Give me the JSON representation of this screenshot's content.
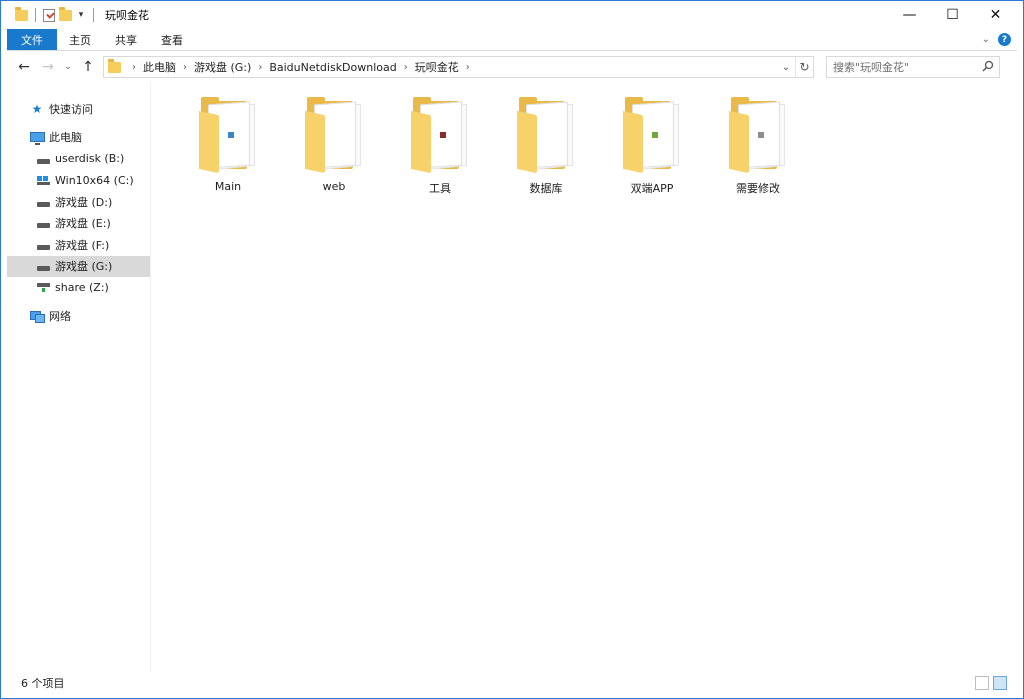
{
  "window": {
    "title": "玩呗金花",
    "controls": {
      "minimize": "—",
      "maximize": "☐",
      "close": "✕"
    }
  },
  "ribbon": {
    "tabs": [
      "文件",
      "主页",
      "共享",
      "查看"
    ]
  },
  "address": {
    "breadcrumbs": [
      "此电脑",
      "游戏盘 (G:)",
      "BaiduNetdiskDownload",
      "玩呗金花"
    ],
    "search_placeholder": "搜索\"玩呗金花\""
  },
  "sidebar": {
    "quick_access": "快速访问",
    "this_pc": "此电脑",
    "drives": [
      {
        "label": "userdisk (B:)",
        "icon": "drive-icon"
      },
      {
        "label": "Win10x64 (C:)",
        "icon": "windows-drive-icon"
      },
      {
        "label": "游戏盘 (D:)",
        "icon": "drive-icon"
      },
      {
        "label": "游戏盘 (E:)",
        "icon": "drive-icon"
      },
      {
        "label": "游戏盘 (F:)",
        "icon": "drive-icon"
      },
      {
        "label": "游戏盘 (G:)",
        "icon": "drive-icon",
        "selected": true
      },
      {
        "label": "share (Z:)",
        "icon": "network-drive-icon"
      }
    ],
    "network": "网络"
  },
  "folders": [
    {
      "name": "Main",
      "mark_color": "#3a84c8"
    },
    {
      "name": "web",
      "mark_color": ""
    },
    {
      "name": "工具",
      "mark_color": "#8a2b2b"
    },
    {
      "name": "数据库",
      "mark_color": ""
    },
    {
      "name": "双端APP",
      "mark_color": "#6fa83a"
    },
    {
      "name": "需要修改",
      "mark_color": "#8d8d8d"
    }
  ],
  "status": {
    "count": "6 个项目"
  },
  "colors": {
    "accent": "#1979ca",
    "folder": "#e9b949",
    "selected": "#d9d9d9"
  }
}
